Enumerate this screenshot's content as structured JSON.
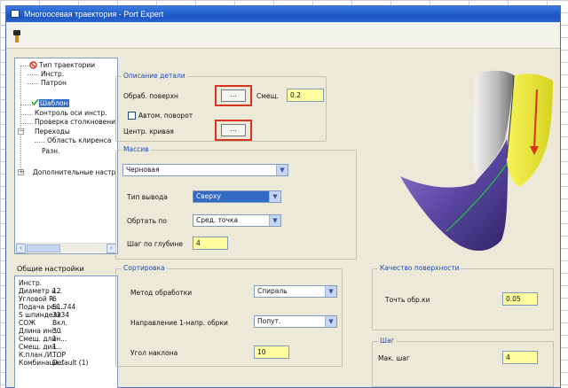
{
  "window": {
    "title": "Многоосевая траектория - Port Expert"
  },
  "tree": {
    "items": [
      "Тип траектории",
      "Инстр.",
      "Патрон",
      "Шаблон",
      "Контроль оси инстр.",
      "Проверка столкновени",
      "Переходы",
      "Область клиренса",
      "Разн.",
      "Дополнительные настр"
    ],
    "expand_plus": "+",
    "expand_minus": "−",
    "scroll_left": "‹",
    "scroll_right": "›"
  },
  "general": {
    "title": "Общие настройки",
    "rows": [
      {
        "label": "Инстр.",
        "value": ""
      },
      {
        "label": "Диаметр и...",
        "value": "12"
      },
      {
        "label": "Угловой R",
        "value": "6"
      },
      {
        "label": "Подача рез...",
        "value": "51.744"
      },
      {
        "label": "S шпинделя",
        "value": "3234"
      },
      {
        "label": "СОЖ",
        "value": "Вкл."
      },
      {
        "label": "Длина инс...",
        "value": "30"
      },
      {
        "label": "Смещ. длин...",
        "value": "1"
      },
      {
        "label": "Смещ. диа...",
        "value": "1"
      },
      {
        "label": "К.план./И...",
        "value": "TOP"
      },
      {
        "label": "Комбинаци...",
        "value": "Default (1)"
      }
    ]
  },
  "part_desc": {
    "title": "Описание детали",
    "surface_label": "Обраб. поверхн",
    "browse_label": "...",
    "offset_label": "Смещ.",
    "offset_value": "0.2",
    "auto_rotate_label": "Автом. поворот",
    "center_curve_label": "Центр. кривая"
  },
  "mass": {
    "title": "Массив",
    "mode_value": "Черновая",
    "output_label": "Тип вывода",
    "output_value": "Сверху",
    "round_label": "Обртать по",
    "round_value": "Сред. точка",
    "step_label": "Шаг по глубине",
    "step_value": "4"
  },
  "sort": {
    "title": "Сортировка",
    "method_label": "Метод обработки",
    "method_value": "Спираль",
    "dir_label": "Направление 1-напр. обрки",
    "dir_value": "Попут.",
    "angle_label": "Угол наклона",
    "angle_value": "10"
  },
  "quality": {
    "title": "Качество поверхности",
    "accuracy_label": "Точть обр.ки",
    "accuracy_value": "0.05"
  },
  "step": {
    "title": "Шаг",
    "max_label": "Мак. шаг",
    "max_value": "4"
  },
  "colors": {
    "group_title": "#1d4ab4",
    "input_yellow": "#ffffa0",
    "highlight_red": "#d9321f",
    "surface_yellow": "#f1ee2a",
    "surface_purple": "#6b56b0"
  }
}
